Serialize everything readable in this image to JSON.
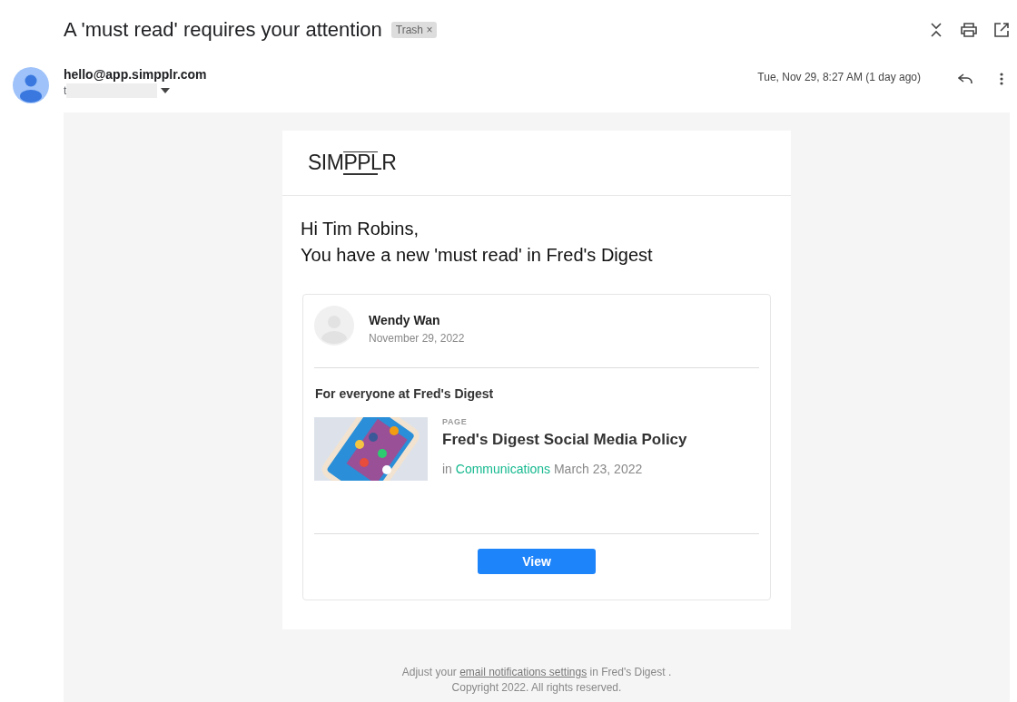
{
  "subject": "A 'must read' requires your attention",
  "label": {
    "text": "Trash",
    "remove": "×"
  },
  "sender": {
    "email": "hello@app.simpplr.com",
    "to": "t",
    "date": "Tue, Nov 29, 8:27 AM (1 day ago)"
  },
  "email": {
    "logo": "SIMPPLR",
    "greeting": "Hi Tim Robins,",
    "headline": "You have a new 'must read' in Fred's Digest",
    "author": {
      "name": "Wendy Wan",
      "date": "November 29, 2022"
    },
    "audience": "For everyone at Fred's Digest",
    "item": {
      "kind": "picture",
      "type": "PAGE",
      "title": "Fred's Digest Social Media Policy",
      "prefix": "in",
      "category": "Communications",
      "date": "March 23, 2022"
    },
    "button": "View"
  },
  "footer": {
    "before": "Adjust your",
    "link": "email notifications settings",
    "after": "in Fred's Digest .",
    "copyright": "Copyright 2022. All rights reserved."
  }
}
